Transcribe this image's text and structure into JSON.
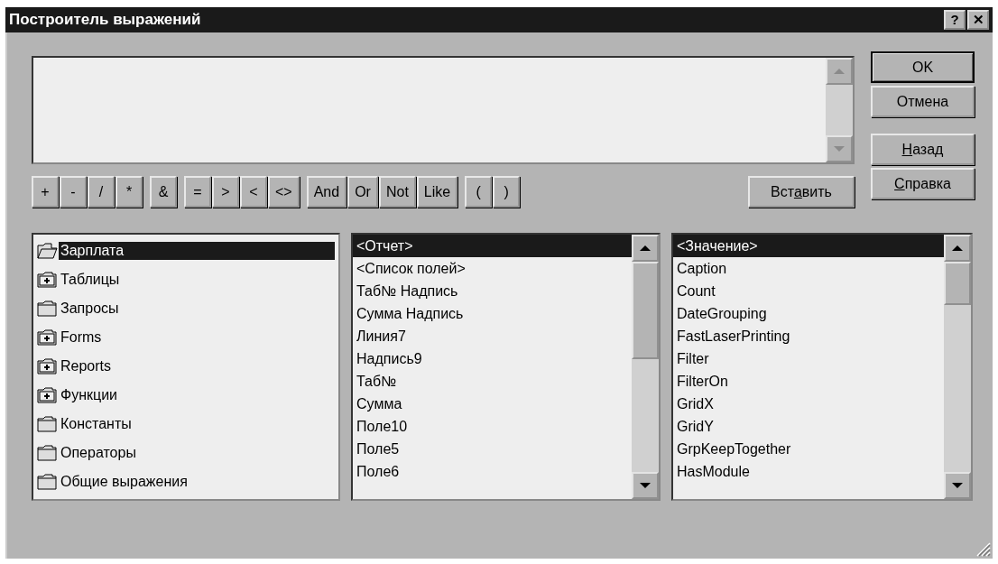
{
  "window": {
    "title": "Построитель выражений",
    "title_buttons": [
      "?",
      "✕"
    ]
  },
  "dialog_buttons": [
    {
      "label_parts": [
        {
          "text": "OK",
          "access_key": false
        }
      ],
      "default": true
    },
    {
      "label_parts": [
        {
          "text": "Отмена",
          "access_key": false
        }
      ],
      "default": false
    },
    {
      "label_parts": [
        {
          "text": "Н",
          "access_key": true
        },
        {
          "text": "азад",
          "access_key": false
        }
      ],
      "default": false
    },
    {
      "label_parts": [
        {
          "text": "С",
          "access_key": true
        },
        {
          "text": "правка",
          "access_key": false
        }
      ],
      "default": false
    }
  ],
  "operator_groups": [
    [
      "+",
      "-",
      "/",
      "*"
    ],
    [
      "&"
    ],
    [
      "=",
      ">",
      "<",
      "<>"
    ],
    [
      "And",
      "Or",
      "Not",
      "Like"
    ],
    [
      "(",
      ")"
    ]
  ],
  "insert_button": {
    "label_parts": [
      {
        "text": "Вст",
        "access_key": false
      },
      {
        "text": "а",
        "access_key": true
      },
      {
        "text": "вить",
        "access_key": false
      }
    ]
  },
  "tree": [
    {
      "label": "Зарплата",
      "kind": "open-folder",
      "selected": true
    },
    {
      "label": "Таблицы",
      "kind": "plus-folder",
      "selected": false
    },
    {
      "label": "Запросы",
      "kind": "folder",
      "selected": false
    },
    {
      "label": "Forms",
      "kind": "plus-folder",
      "selected": false
    },
    {
      "label": "Reports",
      "kind": "plus-folder",
      "selected": false
    },
    {
      "label": "Функции",
      "kind": "plus-folder",
      "selected": false
    },
    {
      "label": "Константы",
      "kind": "folder",
      "selected": false
    },
    {
      "label": "Операторы",
      "kind": "folder",
      "selected": false
    },
    {
      "label": "Общие выражения",
      "kind": "folder",
      "selected": false
    }
  ],
  "objects": [
    {
      "label": "<Отчет>",
      "selected": true
    },
    {
      "label": "<Список полей>",
      "selected": false
    },
    {
      "label": "Таб№ Надпись",
      "selected": false
    },
    {
      "label": "Сумма Надпись",
      "selected": false
    },
    {
      "label": "Линия7",
      "selected": false
    },
    {
      "label": "Надпись9",
      "selected": false
    },
    {
      "label": "Таб№",
      "selected": false
    },
    {
      "label": "Сумма",
      "selected": false
    },
    {
      "label": "Поле10",
      "selected": false
    },
    {
      "label": "Поле5",
      "selected": false
    },
    {
      "label": "Поле6",
      "selected": false
    }
  ],
  "properties": [
    {
      "label": "<Значение>",
      "selected": true
    },
    {
      "label": "Caption",
      "selected": false
    },
    {
      "label": "Count",
      "selected": false
    },
    {
      "label": "DateGrouping",
      "selected": false
    },
    {
      "label": "FastLaserPrinting",
      "selected": false
    },
    {
      "label": "Filter",
      "selected": false
    },
    {
      "label": "FilterOn",
      "selected": false
    },
    {
      "label": "GridX",
      "selected": false
    },
    {
      "label": "GridY",
      "selected": false
    },
    {
      "label": "GrpKeepTogether",
      "selected": false
    },
    {
      "label": "HasModule",
      "selected": false
    }
  ]
}
